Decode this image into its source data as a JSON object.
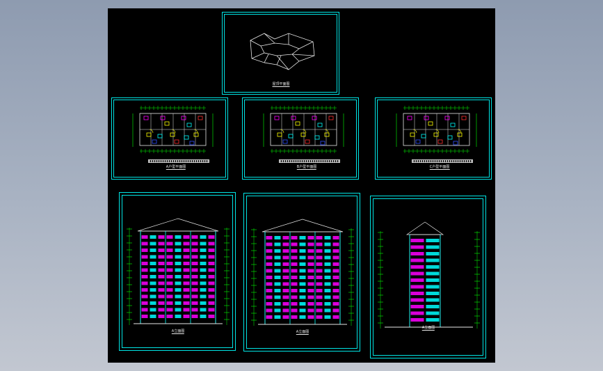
{
  "drawing": {
    "background_color": "#000000",
    "sheet_border_color": "#00e5e5",
    "sheets": [
      {
        "id": "roof-plan",
        "caption": "屋顶平面图"
      },
      {
        "id": "floor-plan-1",
        "caption": "A户型平面图"
      },
      {
        "id": "floor-plan-2",
        "caption": "B户型平面图"
      },
      {
        "id": "floor-plan-3",
        "caption": "C户型平面图"
      },
      {
        "id": "south-elevation",
        "caption": "A立面图"
      },
      {
        "id": "north-elevation",
        "caption": "A立面图"
      },
      {
        "id": "side-elevation",
        "caption": "A立面图"
      }
    ]
  },
  "colors": {
    "line_white": "#e8e8e8",
    "cyan": "#00ffff",
    "magenta": "#ff00ff",
    "green": "#00ff00",
    "yellow": "#ffff00",
    "red": "#ff3030",
    "blue": "#3050ff"
  }
}
